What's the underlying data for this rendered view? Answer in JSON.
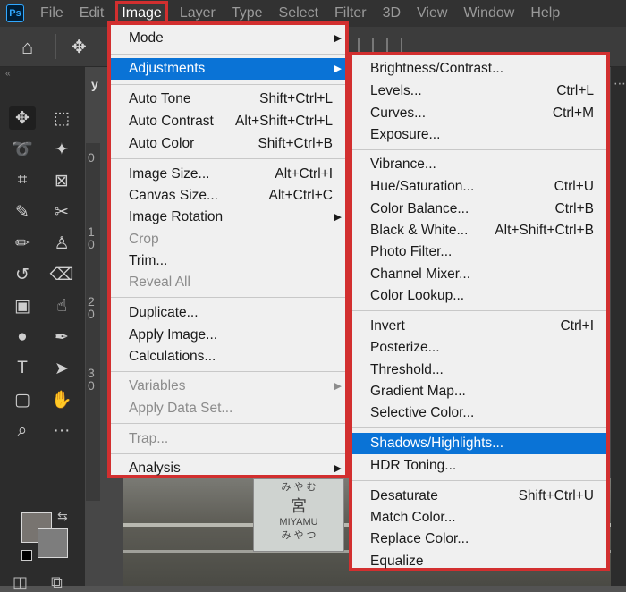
{
  "menubar": {
    "logo": "Ps",
    "items": [
      "File",
      "Edit",
      "Image",
      "Layer",
      "Type",
      "Select",
      "Filter",
      "3D",
      "View",
      "Window",
      "Help"
    ]
  },
  "document": {
    "tab_fragment": "y",
    "ruler_labels": [
      "0",
      "1\n0",
      "2\n0",
      "3\n0"
    ],
    "sign_text": [
      "み や む",
      "宮",
      "MIYAMU",
      "み や つ"
    ]
  },
  "toolbar": {
    "collapse": "«",
    "tools": [
      "move-tool",
      "marquee-tool",
      "lasso-tool",
      "magic-wand-tool",
      "crop-tool",
      "frame-tool",
      "eyedropper-tool",
      "healing-tool",
      "brush-tool",
      "stamp-tool",
      "history-brush-tool",
      "eraser-tool",
      "gradient-tool",
      "smudge-tool",
      "dodge-tool",
      "pen-tool",
      "type-tool",
      "path-select-tool",
      "shape-tool",
      "hand-tool",
      "zoom-tool",
      "more-tools"
    ],
    "fg_color": "#787470",
    "bg_color": "#7d7d7d"
  },
  "image_menu": {
    "items": [
      {
        "label": "Mode",
        "shortcut": "",
        "submenu": true,
        "disabled": false
      },
      {
        "label": "Adjustments",
        "shortcut": "",
        "submenu": true,
        "disabled": false,
        "highlighted": true
      },
      {
        "label": "Auto Tone",
        "shortcut": "Shift+Ctrl+L",
        "disabled": false
      },
      {
        "label": "Auto Contrast",
        "shortcut": "Alt+Shift+Ctrl+L",
        "disabled": false
      },
      {
        "label": "Auto Color",
        "shortcut": "Shift+Ctrl+B",
        "disabled": false
      },
      {
        "label": "Image Size...",
        "shortcut": "Alt+Ctrl+I",
        "disabled": false
      },
      {
        "label": "Canvas Size...",
        "shortcut": "Alt+Ctrl+C",
        "disabled": false
      },
      {
        "label": "Image Rotation",
        "shortcut": "",
        "submenu": true,
        "disabled": false
      },
      {
        "label": "Crop",
        "shortcut": "",
        "disabled": true
      },
      {
        "label": "Trim...",
        "shortcut": "",
        "disabled": false
      },
      {
        "label": "Reveal All",
        "shortcut": "",
        "disabled": true
      },
      {
        "label": "Duplicate...",
        "shortcut": "",
        "disabled": false
      },
      {
        "label": "Apply Image...",
        "shortcut": "",
        "disabled": false
      },
      {
        "label": "Calculations...",
        "shortcut": "",
        "disabled": false
      },
      {
        "label": "Variables",
        "shortcut": "",
        "submenu": true,
        "disabled": true
      },
      {
        "label": "Apply Data Set...",
        "shortcut": "",
        "disabled": true
      },
      {
        "label": "Trap...",
        "shortcut": "",
        "disabled": true
      },
      {
        "label": "Analysis",
        "shortcut": "",
        "submenu": true,
        "disabled": false
      }
    ]
  },
  "adjustments_menu": {
    "items": [
      {
        "label": "Brightness/Contrast...",
        "shortcut": ""
      },
      {
        "label": "Levels...",
        "shortcut": "Ctrl+L"
      },
      {
        "label": "Curves...",
        "shortcut": "Ctrl+M"
      },
      {
        "label": "Exposure...",
        "shortcut": ""
      },
      {
        "label": "Vibrance...",
        "shortcut": ""
      },
      {
        "label": "Hue/Saturation...",
        "shortcut": "Ctrl+U"
      },
      {
        "label": "Color Balance...",
        "shortcut": "Ctrl+B"
      },
      {
        "label": "Black & White...",
        "shortcut": "Alt+Shift+Ctrl+B"
      },
      {
        "label": "Photo Filter...",
        "shortcut": ""
      },
      {
        "label": "Channel Mixer...",
        "shortcut": ""
      },
      {
        "label": "Color Lookup...",
        "shortcut": ""
      },
      {
        "label": "Invert",
        "shortcut": "Ctrl+I"
      },
      {
        "label": "Posterize...",
        "shortcut": ""
      },
      {
        "label": "Threshold...",
        "shortcut": ""
      },
      {
        "label": "Gradient Map...",
        "shortcut": ""
      },
      {
        "label": "Selective Color...",
        "shortcut": ""
      },
      {
        "label": "Shadows/Highlights...",
        "shortcut": "",
        "highlighted": true
      },
      {
        "label": "HDR Toning...",
        "shortcut": ""
      },
      {
        "label": "Desaturate",
        "shortcut": "Shift+Ctrl+U"
      },
      {
        "label": "Match Color...",
        "shortcut": ""
      },
      {
        "label": "Replace Color...",
        "shortcut": ""
      },
      {
        "label": "Equalize",
        "shortcut": ""
      }
    ]
  },
  "colors": {
    "highlight": "#0a73d6",
    "annotation_border": "#d22f2f"
  }
}
